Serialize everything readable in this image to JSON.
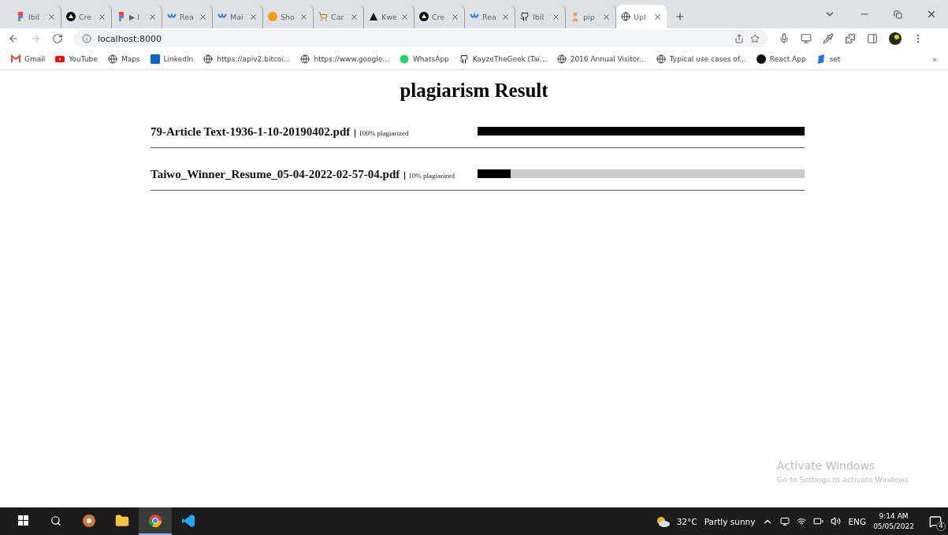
{
  "browser": {
    "tabs": [
      {
        "title": "Ibil",
        "selected": false
      },
      {
        "title": "Cre",
        "selected": false
      },
      {
        "title": "▶ I",
        "selected": false
      },
      {
        "title": "Rea",
        "selected": false
      },
      {
        "title": "Mai",
        "selected": false
      },
      {
        "title": "Sho",
        "selected": false
      },
      {
        "title": "Car",
        "selected": false
      },
      {
        "title": "Kwe",
        "selected": false
      },
      {
        "title": "Cre",
        "selected": false
      },
      {
        "title": "Rea",
        "selected": false
      },
      {
        "title": "Ibil",
        "selected": false
      },
      {
        "title": "pip",
        "selected": false
      },
      {
        "title": "Upl",
        "selected": true
      }
    ],
    "address": "localhost:8000",
    "forward_disabled": true,
    "bookmarks": [
      "Gmail",
      "YouTube",
      "Maps",
      "LinkedIn",
      "https://apiv2.bitcoi...",
      "https://www.google...",
      "WhatsApp",
      "KayzeTheGeek (Tai...",
      "2016 Annual Visitor...",
      "Typical use cases of...",
      "React App",
      "set"
    ],
    "bookmarks_more": "»"
  },
  "page": {
    "title": "plagiarism Result",
    "results": [
      {
        "file": "79-Article Text-1936-1-10-20190402.pdf",
        "score": "100% plagiarized",
        "level": 1
      },
      {
        "file": "Taiwo_Winner_Resume_05-04-2022-02-57-04.pdf",
        "score": "10% plagiarized",
        "level": 0.1
      }
    ]
  },
  "activation_notice": {
    "title": "Activate Windows",
    "subtitle": "Go to Settings to activate Windows."
  },
  "taskbar": {
    "apps": [
      {
        "selected": false
      },
      {
        "selected": false
      },
      {
        "selected": true
      },
      {
        "selected": false
      }
    ],
    "temperature": "32°C",
    "weather": "Partly sunny",
    "language": "ENG",
    "time": "9:14 AM",
    "date": "05/05/2022",
    "notifications": "4"
  }
}
